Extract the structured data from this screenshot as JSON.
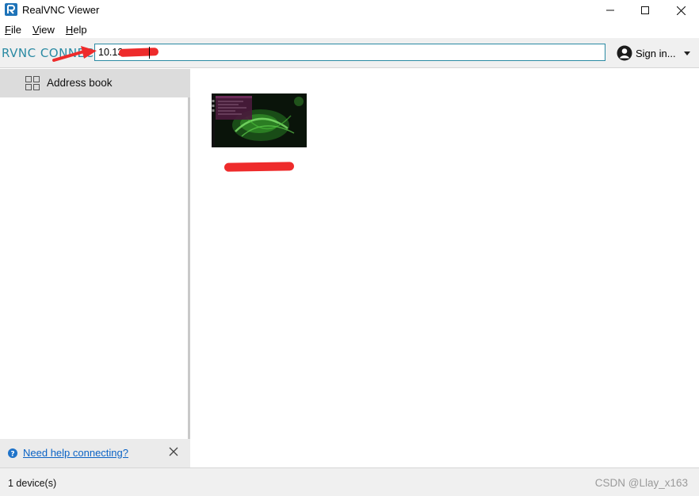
{
  "window": {
    "title": "RealVNC Viewer",
    "controls": [
      "minimize",
      "maximize",
      "close"
    ]
  },
  "menu": {
    "items": [
      {
        "label": "File",
        "mnemonic": "F"
      },
      {
        "label": "View",
        "mnemonic": "V"
      },
      {
        "label": "Help",
        "mnemonic": "H"
      }
    ]
  },
  "toolbar": {
    "brand_text": "RVNC CONNECT",
    "address_value": "10.13",
    "sign_in_label": "Sign in...",
    "accent_color": "#2a8aa3",
    "annotation_color": "#ee2b2b"
  },
  "sidebar": {
    "address_book_label": "Address book",
    "help_link_label": "Need help connecting?"
  },
  "main": {
    "devices": [
      {
        "name_redacted": true
      }
    ]
  },
  "status": {
    "device_count": "1 device(s)",
    "watermark": "CSDN @Llay_x163"
  },
  "icons": {
    "app": "realvnc-logo-icon",
    "address_book": "grid-icon",
    "user": "user-avatar-icon",
    "help": "question-circle-icon",
    "close": "close-icon",
    "dropdown": "caret-down-icon"
  }
}
